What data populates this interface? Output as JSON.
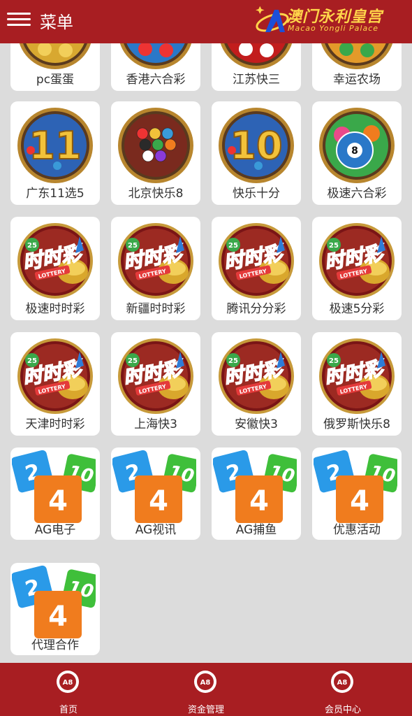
{
  "header": {
    "menu_label": "菜单",
    "logo_cn": "澳门永利皇宫",
    "logo_en": "Macao Yongli Palace"
  },
  "games": [
    {
      "label": "pc蛋蛋",
      "icon": "coins-lottery-icon"
    },
    {
      "label": "香港六合彩",
      "icon": "hk-mark-six-icon"
    },
    {
      "label": "江苏快三",
      "icon": "dice-icon"
    },
    {
      "label": "幸运农场",
      "icon": "lucky-farm-icon"
    },
    {
      "label": "广东11选5",
      "icon": "number-11-icon"
    },
    {
      "label": "北京快乐8",
      "icon": "billiard-balls-icon"
    },
    {
      "label": "快乐十分",
      "icon": "number-10-icon"
    },
    {
      "label": "极速六合彩",
      "icon": "eight-ball-icon"
    },
    {
      "label": "极速时时彩",
      "icon": "ssc-lottery-icon"
    },
    {
      "label": "新疆时时彩",
      "icon": "ssc-lottery-icon"
    },
    {
      "label": "腾讯分分彩",
      "icon": "ssc-lottery-icon"
    },
    {
      "label": "极速5分彩",
      "icon": "ssc-lottery-icon"
    },
    {
      "label": "天津时时彩",
      "icon": "ssc-lottery-icon"
    },
    {
      "label": "上海快3",
      "icon": "ssc-lottery-icon"
    },
    {
      "label": "安徽快3",
      "icon": "ssc-lottery-icon"
    },
    {
      "label": "俄罗斯快乐8",
      "icon": "ssc-lottery-icon"
    },
    {
      "label": "AG电子",
      "icon": "number-tiles-icon"
    },
    {
      "label": "AG视讯",
      "icon": "number-tiles-icon"
    },
    {
      "label": "AG捕鱼",
      "icon": "number-tiles-icon"
    },
    {
      "label": "优惠活动",
      "icon": "number-tiles-icon"
    },
    {
      "label": "代理合作",
      "icon": "number-tiles-icon"
    }
  ],
  "icon_text": {
    "ssc": "时时彩",
    "ssc_sub": "LOTTERY",
    "ssc_ball": "25",
    "eleven": "11",
    "ten": "10",
    "eight": "8",
    "tile_a": "2",
    "tile_b": "10",
    "tile_c": "4"
  },
  "bottom_nav": {
    "badge": "A8",
    "tabs": [
      {
        "label": "首页"
      },
      {
        "label": "资金管理"
      },
      {
        "label": "会员中心"
      }
    ]
  },
  "colors": {
    "brand": "#a81e22",
    "gold": "#ffd54a",
    "background": "#dcdcdc"
  }
}
